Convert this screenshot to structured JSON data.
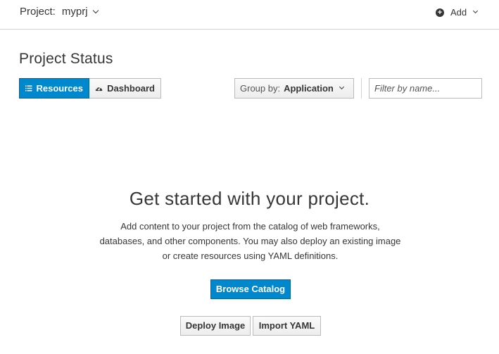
{
  "topbar": {
    "project_label": "Project:",
    "project_name": "myprj",
    "add_label": "Add",
    "add_icon": "plus-circle-icon"
  },
  "page": {
    "title": "Project Status"
  },
  "view_toggle": {
    "resources_label": "Resources",
    "resources_icon": "list-icon",
    "dashboard_label": "Dashboard",
    "dashboard_icon": "tachometer-icon",
    "active": "Resources"
  },
  "group_by": {
    "label": "Group by:",
    "value": "Application"
  },
  "filter": {
    "placeholder": "Filter by name...",
    "value": ""
  },
  "empty_state": {
    "title": "Get started with your project.",
    "description": "Add content to your project from the catalog of web frameworks, databases, and other components. You may also deploy an existing image or create resources using YAML definitions.",
    "primary_action": "Browse Catalog",
    "secondary_actions": [
      "Deploy Image",
      "Import YAML"
    ]
  },
  "colors": {
    "primary": "#0088ce",
    "text": "#363636",
    "border": "#bbbbbb"
  }
}
